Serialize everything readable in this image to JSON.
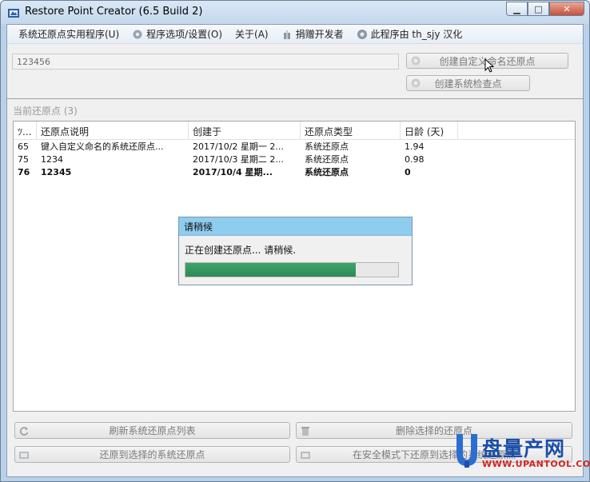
{
  "window": {
    "title": "Restore Point Creator (6.5 Build 2)",
    "controls": {
      "minimize": "▁",
      "maximize": "□",
      "close": "✕"
    }
  },
  "menu": {
    "items": [
      {
        "label": "系统还原点实用程序(U)",
        "icon": ""
      },
      {
        "label": "程序选项/设置(O)",
        "icon": "gear-icon"
      },
      {
        "label": "关于(A)",
        "icon": ""
      },
      {
        "label": "捐赠开发者",
        "icon": "gift-icon"
      },
      {
        "label": "此程序由 th_sjy 汉化",
        "icon": "info-icon"
      }
    ]
  },
  "create": {
    "name_value": "123456",
    "custom_button": "创建自定义命名还原点",
    "check_button": "创建系统检查点"
  },
  "current": {
    "label": "当前还原点 (3)"
  },
  "list": {
    "columns": [
      "ﾂ...",
      "还原点说明",
      "创建于",
      "还原点类型",
      "日龄 (天)"
    ],
    "rows": [
      {
        "id": "65",
        "description": "键入自定义命名的系统还原点...",
        "created": "2017/10/2 星期一 2...",
        "type": "系统还原点",
        "age": "1.94",
        "bold": false
      },
      {
        "id": "75",
        "description": "1234",
        "created": "2017/10/3 星期二 2...",
        "type": "系统还原点",
        "age": "0.98",
        "bold": false
      },
      {
        "id": "76",
        "description": "12345",
        "created": "2017/10/4 星期...",
        "type": "系统还原点",
        "age": "0",
        "bold": true
      }
    ]
  },
  "wait_dialog": {
    "title": "请稍候",
    "message": "正在创建还原点... 请稍候.",
    "progress": 0.8
  },
  "bottom": {
    "refresh": "刷新系统还原点列表",
    "delete": "删除选择的还原点",
    "restore": "还原到选择的系统还原点",
    "restore_safe": "在安全模式下还原到选择的系统还原点"
  },
  "watermark": {
    "brand_cn": "盘量产网",
    "url": "WWW.UPANTOOL.COM"
  },
  "colors": {
    "progress": "#2d8a55",
    "dialog_title": "#8fcdee",
    "watermark_blue": "#1b4fa8",
    "watermark_red": "#d42424"
  }
}
